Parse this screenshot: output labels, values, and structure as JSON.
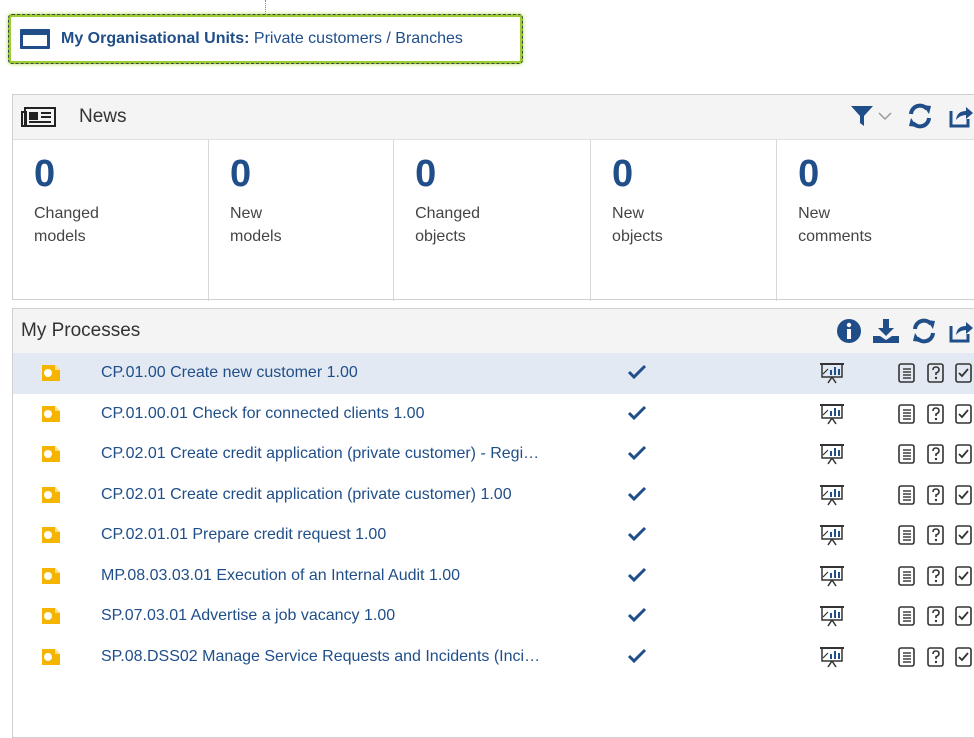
{
  "org_unit": {
    "label": "My Organisational Units:",
    "path": "Private customers / Branches"
  },
  "news": {
    "title": "News",
    "icons": [
      "newspaper-icon",
      "filter-icon",
      "chevron-down-icon",
      "refresh-icon",
      "share-icon"
    ],
    "tiles": [
      {
        "count": "0",
        "line1": "Changed",
        "line2": "models"
      },
      {
        "count": "0",
        "line1": "New",
        "line2": "models"
      },
      {
        "count": "0",
        "line1": "Changed",
        "line2": "objects"
      },
      {
        "count": "0",
        "line1": "New",
        "line2": "objects"
      },
      {
        "count": "0",
        "line1": "New",
        "line2": "comments"
      }
    ]
  },
  "processes": {
    "title": "My Processes",
    "icons": [
      "info-icon",
      "download-icon",
      "refresh-icon",
      "share-icon"
    ],
    "rows": [
      {
        "name": "CP.01.00 Create new customer 1.00"
      },
      {
        "name": "CP.01.00.01 Check for connected clients 1.00"
      },
      {
        "name": "CP.02.01 Create credit application (private customer) - Regi…"
      },
      {
        "name": "CP.02.01 Create credit application (private customer) 1.00"
      },
      {
        "name": "CP.02.01.01 Prepare credit request 1.00"
      },
      {
        "name": "MP.08.03.03.01 Execution of an Internal Audit 1.00"
      },
      {
        "name": "SP.07.03.01 Advertise a job vacancy 1.00"
      },
      {
        "name": "SP.08.DSS02 Manage Service Requests and Incidents (Inci…"
      }
    ],
    "selected_index": 0
  },
  "colors": {
    "brand_blue": "#1f4e89",
    "highlight_green": "#9acd32",
    "process_orange": "#f5b400",
    "selected_row": "#e3e9f2"
  }
}
